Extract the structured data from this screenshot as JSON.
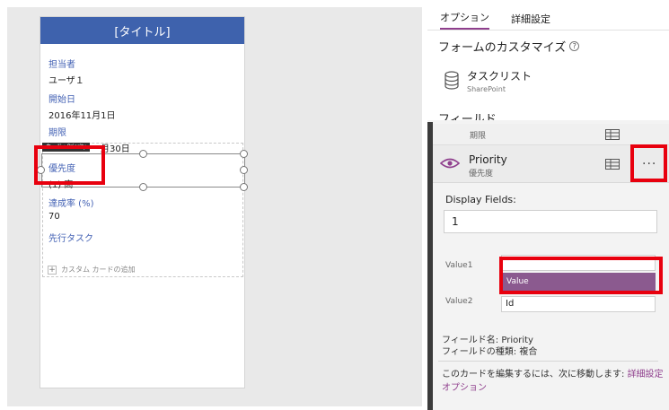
{
  "form": {
    "title": "[タイトル]",
    "fields": [
      {
        "label": "担当者",
        "value": "ユーザ１"
      },
      {
        "label": "開始日",
        "value": "2016年11月1日"
      },
      {
        "label": "期限",
        "value": "月30日"
      },
      {
        "label": "優先度",
        "value": "(1) 高"
      },
      {
        "label": "達成率 (%)",
        "value": "70"
      },
      {
        "label": "先行タスク",
        "value": ""
      }
    ],
    "card_tag": "カード : Priority",
    "add_card": "カスタム カードの追加"
  },
  "panel": {
    "tabs": [
      "オプション",
      "詳細設定"
    ],
    "customize_title": "フォームのカスタマイズ",
    "help_icon": "?",
    "datasource": {
      "name": "タスクリスト",
      "type": "SharePoint"
    },
    "fields_title": "フィールド",
    "prev_field": "期限",
    "field": {
      "name": "Priority",
      "sub": "優先度"
    },
    "more_label": "···",
    "display_fields_label": "Display Fields:",
    "display_fields_value": "1",
    "value1_label": "Value1",
    "value1_option": "Value",
    "value2_label": "Value2",
    "value2_value": "Id",
    "field_name_line": "フィールド名: Priority",
    "field_type_line": "フィールドの種類: 複合",
    "edit_note_prefix": "このカードを編集するには、次に移動します: ",
    "edit_note_link": "詳細設定オプション"
  },
  "colors": {
    "header": "#3e62ad",
    "accent": "#8f3f8d",
    "highlight": "#e8000e",
    "option": "#8b5a8f"
  }
}
